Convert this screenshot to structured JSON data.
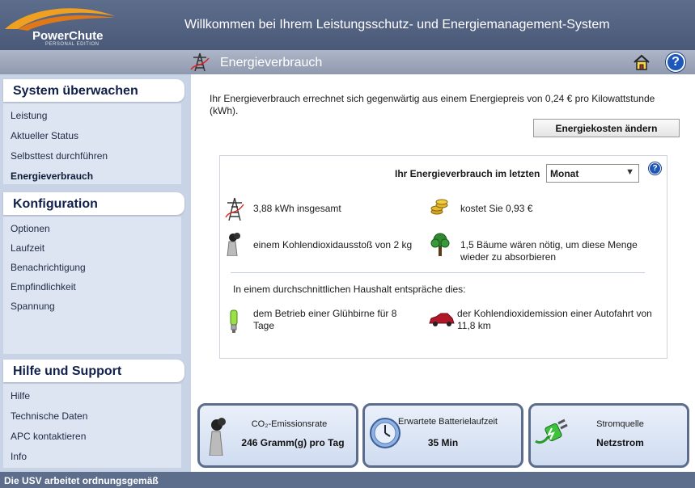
{
  "header": {
    "logo": "PowerChute",
    "logo_sub": "PERSONAL EDITION",
    "title": "Willkommen bei Ihrem Leistungsschutz- und Energiemanagement-System"
  },
  "subheader": {
    "title": "Energieverbrauch",
    "help_glyph": "?"
  },
  "sidebar": {
    "sections": [
      {
        "title": "System überwachen",
        "items": [
          "Leistung",
          "Aktueller Status",
          "Selbsttest durchführen",
          "Energieverbrauch"
        ]
      },
      {
        "title": "Konfiguration",
        "items": [
          "Optionen",
          "Laufzeit",
          "Benachrichtigung",
          "Empfindlichkeit",
          "Spannung"
        ]
      },
      {
        "title": "Hilfe und Support",
        "items": [
          "Hilfe",
          "Technische Daten",
          "APC kontaktieren",
          "Info"
        ]
      }
    ]
  },
  "main": {
    "intro": "Ihr Energieverbrauch errechnet sich gegenwärtig aus einem Energiepreis von 0,24 € pro Kilowattstunde (kWh).",
    "change_cost_button": "Energiekosten ändern",
    "period_label": "Ihr Energieverbrauch im letzten",
    "period_value": "Monat",
    "help_glyph": "?",
    "stats": {
      "total": "3,88 kWh insgesamt",
      "cost": "kostet Sie  0,93 €",
      "co2": "einem Kohlendioxidausstoß von 2 kg",
      "trees": "1,5 Bäume wären nötig, um diese Menge wieder zu absorbieren"
    },
    "household_intro": "In einem durchschnittlichen Haushalt entspräche dies:",
    "household": {
      "bulb": "dem Betrieb einer Glühbirne für 8 Tage",
      "car": "der Kohlendioxidemission einer Autofahrt von 11,8 km"
    }
  },
  "cards": {
    "co2": {
      "title": "CO₂-Emissionsrate",
      "value": "246 Gramm(g) pro Tag"
    },
    "battery": {
      "title": "Erwartete Batterielaufzeit",
      "value": "35 Min"
    },
    "source": {
      "title": "Stromquelle",
      "value": "Netzstrom"
    }
  },
  "status": "Die USV arbeitet ordnungsgemäß",
  "colors": {
    "header_bg": "#5d6d8c",
    "sidebar_bg": "#c9d3e6",
    "panel_bg": "#dde5f2",
    "help_blue": "#1c57b9"
  }
}
